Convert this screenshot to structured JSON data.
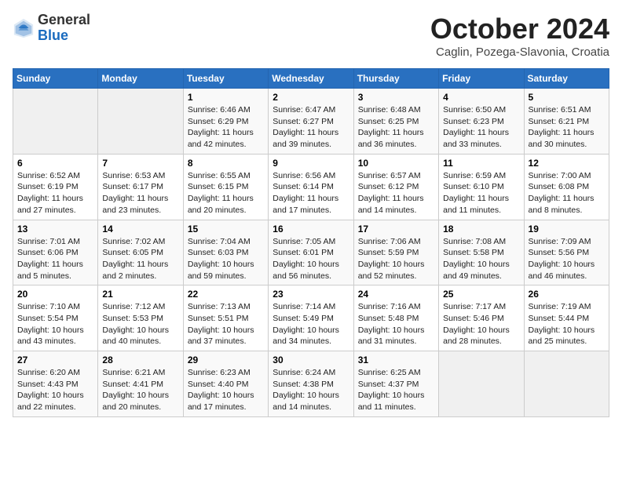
{
  "logo": {
    "general": "General",
    "blue": "Blue"
  },
  "title": "October 2024",
  "subtitle": "Caglin, Pozega-Slavonia, Croatia",
  "days_of_week": [
    "Sunday",
    "Monday",
    "Tuesday",
    "Wednesday",
    "Thursday",
    "Friday",
    "Saturday"
  ],
  "weeks": [
    [
      {
        "day": "",
        "empty": true
      },
      {
        "day": "",
        "empty": true
      },
      {
        "day": "1",
        "sunrise": "Sunrise: 6:46 AM",
        "sunset": "Sunset: 6:29 PM",
        "daylight": "Daylight: 11 hours and 42 minutes."
      },
      {
        "day": "2",
        "sunrise": "Sunrise: 6:47 AM",
        "sunset": "Sunset: 6:27 PM",
        "daylight": "Daylight: 11 hours and 39 minutes."
      },
      {
        "day": "3",
        "sunrise": "Sunrise: 6:48 AM",
        "sunset": "Sunset: 6:25 PM",
        "daylight": "Daylight: 11 hours and 36 minutes."
      },
      {
        "day": "4",
        "sunrise": "Sunrise: 6:50 AM",
        "sunset": "Sunset: 6:23 PM",
        "daylight": "Daylight: 11 hours and 33 minutes."
      },
      {
        "day": "5",
        "sunrise": "Sunrise: 6:51 AM",
        "sunset": "Sunset: 6:21 PM",
        "daylight": "Daylight: 11 hours and 30 minutes."
      }
    ],
    [
      {
        "day": "6",
        "sunrise": "Sunrise: 6:52 AM",
        "sunset": "Sunset: 6:19 PM",
        "daylight": "Daylight: 11 hours and 27 minutes."
      },
      {
        "day": "7",
        "sunrise": "Sunrise: 6:53 AM",
        "sunset": "Sunset: 6:17 PM",
        "daylight": "Daylight: 11 hours and 23 minutes."
      },
      {
        "day": "8",
        "sunrise": "Sunrise: 6:55 AM",
        "sunset": "Sunset: 6:15 PM",
        "daylight": "Daylight: 11 hours and 20 minutes."
      },
      {
        "day": "9",
        "sunrise": "Sunrise: 6:56 AM",
        "sunset": "Sunset: 6:14 PM",
        "daylight": "Daylight: 11 hours and 17 minutes."
      },
      {
        "day": "10",
        "sunrise": "Sunrise: 6:57 AM",
        "sunset": "Sunset: 6:12 PM",
        "daylight": "Daylight: 11 hours and 14 minutes."
      },
      {
        "day": "11",
        "sunrise": "Sunrise: 6:59 AM",
        "sunset": "Sunset: 6:10 PM",
        "daylight": "Daylight: 11 hours and 11 minutes."
      },
      {
        "day": "12",
        "sunrise": "Sunrise: 7:00 AM",
        "sunset": "Sunset: 6:08 PM",
        "daylight": "Daylight: 11 hours and 8 minutes."
      }
    ],
    [
      {
        "day": "13",
        "sunrise": "Sunrise: 7:01 AM",
        "sunset": "Sunset: 6:06 PM",
        "daylight": "Daylight: 11 hours and 5 minutes."
      },
      {
        "day": "14",
        "sunrise": "Sunrise: 7:02 AM",
        "sunset": "Sunset: 6:05 PM",
        "daylight": "Daylight: 11 hours and 2 minutes."
      },
      {
        "day": "15",
        "sunrise": "Sunrise: 7:04 AM",
        "sunset": "Sunset: 6:03 PM",
        "daylight": "Daylight: 10 hours and 59 minutes."
      },
      {
        "day": "16",
        "sunrise": "Sunrise: 7:05 AM",
        "sunset": "Sunset: 6:01 PM",
        "daylight": "Daylight: 10 hours and 56 minutes."
      },
      {
        "day": "17",
        "sunrise": "Sunrise: 7:06 AM",
        "sunset": "Sunset: 5:59 PM",
        "daylight": "Daylight: 10 hours and 52 minutes."
      },
      {
        "day": "18",
        "sunrise": "Sunrise: 7:08 AM",
        "sunset": "Sunset: 5:58 PM",
        "daylight": "Daylight: 10 hours and 49 minutes."
      },
      {
        "day": "19",
        "sunrise": "Sunrise: 7:09 AM",
        "sunset": "Sunset: 5:56 PM",
        "daylight": "Daylight: 10 hours and 46 minutes."
      }
    ],
    [
      {
        "day": "20",
        "sunrise": "Sunrise: 7:10 AM",
        "sunset": "Sunset: 5:54 PM",
        "daylight": "Daylight: 10 hours and 43 minutes."
      },
      {
        "day": "21",
        "sunrise": "Sunrise: 7:12 AM",
        "sunset": "Sunset: 5:53 PM",
        "daylight": "Daylight: 10 hours and 40 minutes."
      },
      {
        "day": "22",
        "sunrise": "Sunrise: 7:13 AM",
        "sunset": "Sunset: 5:51 PM",
        "daylight": "Daylight: 10 hours and 37 minutes."
      },
      {
        "day": "23",
        "sunrise": "Sunrise: 7:14 AM",
        "sunset": "Sunset: 5:49 PM",
        "daylight": "Daylight: 10 hours and 34 minutes."
      },
      {
        "day": "24",
        "sunrise": "Sunrise: 7:16 AM",
        "sunset": "Sunset: 5:48 PM",
        "daylight": "Daylight: 10 hours and 31 minutes."
      },
      {
        "day": "25",
        "sunrise": "Sunrise: 7:17 AM",
        "sunset": "Sunset: 5:46 PM",
        "daylight": "Daylight: 10 hours and 28 minutes."
      },
      {
        "day": "26",
        "sunrise": "Sunrise: 7:19 AM",
        "sunset": "Sunset: 5:44 PM",
        "daylight": "Daylight: 10 hours and 25 minutes."
      }
    ],
    [
      {
        "day": "27",
        "sunrise": "Sunrise: 6:20 AM",
        "sunset": "Sunset: 4:43 PM",
        "daylight": "Daylight: 10 hours and 22 minutes."
      },
      {
        "day": "28",
        "sunrise": "Sunrise: 6:21 AM",
        "sunset": "Sunset: 4:41 PM",
        "daylight": "Daylight: 10 hours and 20 minutes."
      },
      {
        "day": "29",
        "sunrise": "Sunrise: 6:23 AM",
        "sunset": "Sunset: 4:40 PM",
        "daylight": "Daylight: 10 hours and 17 minutes."
      },
      {
        "day": "30",
        "sunrise": "Sunrise: 6:24 AM",
        "sunset": "Sunset: 4:38 PM",
        "daylight": "Daylight: 10 hours and 14 minutes."
      },
      {
        "day": "31",
        "sunrise": "Sunrise: 6:25 AM",
        "sunset": "Sunset: 4:37 PM",
        "daylight": "Daylight: 10 hours and 11 minutes."
      },
      {
        "day": "",
        "empty": true
      },
      {
        "day": "",
        "empty": true
      }
    ]
  ]
}
